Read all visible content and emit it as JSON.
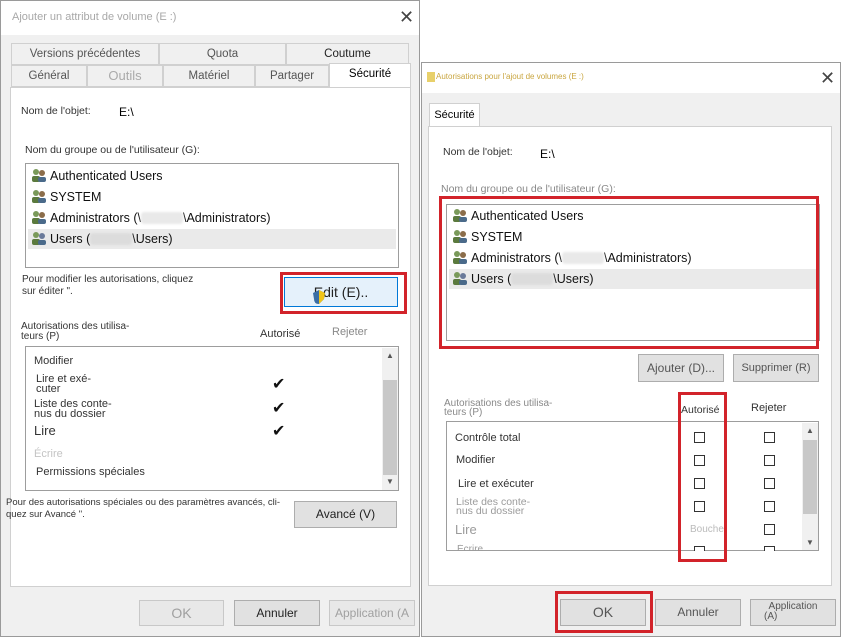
{
  "left": {
    "title": "Ajouter un attribut de volume (E :)",
    "tabs_row1": [
      "Versions précédentes",
      "Quota",
      "Coutume"
    ],
    "tabs_row2": [
      "Général",
      "Outils",
      "Matériel",
      "Partager",
      "Sécurité"
    ],
    "object_label": "Nom de l'objet:",
    "object_value": "E:\\",
    "group_label": "Nom du groupe ou de l'utilisateur (G):",
    "users": [
      {
        "name": "Authenticated Users",
        "icon": "users-icon"
      },
      {
        "name": "SYSTEM",
        "icon": "users-icon"
      },
      {
        "name": "Administrators (\\",
        "suffix": "\\Administrators)",
        "icon": "users-icon"
      },
      {
        "name": "Users (",
        "suffix": "\\Users)",
        "icon": "users-icon"
      }
    ],
    "modify_note_1": "Pour modifier les autorisations, cliquez",
    "modify_note_2": "sur éditer \".",
    "edit_button": "Edit (E)..",
    "perm_label_1": "Autorisations des utilisa-",
    "perm_label_2": "teurs (P)",
    "col_allow": "Autorisé",
    "col_deny": "Rejeter",
    "permissions": [
      {
        "label": "Modifier",
        "allow": false
      },
      {
        "label": "Lire et exé-",
        "label2": "cuter",
        "allow": true
      },
      {
        "label": "Liste des conte-",
        "label2": "nus du dossier",
        "allow": true
      },
      {
        "label": "Lire",
        "allow": true
      },
      {
        "label": "Écrire",
        "allow": false
      },
      {
        "label": "Permissions spéciales",
        "allow": false
      }
    ],
    "advanced_note_1": "Pour des autorisations spéciales ou des paramètres avancés, cli-",
    "advanced_note_2": "quez sur Avancé \".",
    "advanced_button": "Avancé (V)",
    "ok_button": "OK",
    "cancel_button": "Annuler",
    "apply_button": "Application (A"
  },
  "right": {
    "title": "Autorisations pour l'ajout de volumes (E :)",
    "tab": "Sécurité",
    "object_label": "Nom de l'objet:",
    "object_value": "E:\\",
    "group_label": "Nom du groupe ou de l'utilisateur (G):",
    "users": [
      {
        "name": "Authenticated Users",
        "icon": "users-icon"
      },
      {
        "name": "SYSTEM",
        "icon": "users-icon"
      },
      {
        "name": "Administrators (\\",
        "suffix": "\\Administrators)",
        "icon": "users-icon"
      },
      {
        "name": "Users (",
        "suffix": "\\Users)",
        "icon": "users-icon"
      }
    ],
    "add_button": "Ajouter (D)...",
    "remove_button": "Supprimer (R)",
    "perm_label_1": "Autorisations des utilisa-",
    "perm_label_2": "teurs (P)",
    "col_allow": "Autorisé",
    "col_deny": "Rejeter",
    "permissions": [
      {
        "label": "Contrôle total"
      },
      {
        "label": "Modifier"
      },
      {
        "label": "Lire et exécuter"
      },
      {
        "label": "Liste des conte-",
        "label2": "nus du dossier"
      },
      {
        "label": "Lire"
      },
      {
        "label": "Écrire"
      }
    ],
    "bouche_text": "Bouche",
    "ok_button": "OK",
    "cancel_button": "Annuler",
    "apply_button_1": "Application",
    "apply_button_2": "(A)"
  },
  "colors": {
    "highlight": "#d2232a",
    "focus": "#0078d7"
  }
}
